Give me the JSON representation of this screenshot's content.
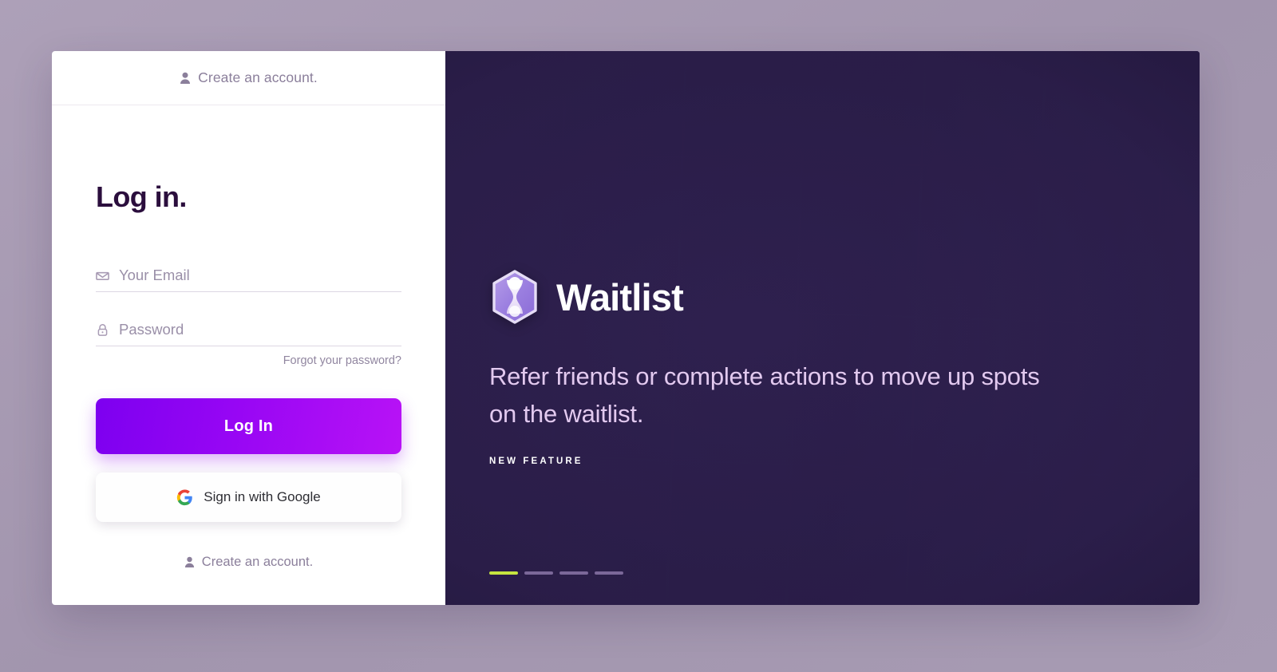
{
  "theme": {
    "page_bg": "#a99cb5",
    "panel_bg": "#2f2150",
    "accent_start": "#7d00f0",
    "accent_end": "#b812f6",
    "title_color": "#2b0e3d",
    "active_dot": "#c6e53f",
    "inactive_dot": "#7b6899",
    "tagline_color": "#e2c9ef"
  },
  "left": {
    "header_link": {
      "label": "Create an account.",
      "icon": "person-icon"
    },
    "title": "Log in.",
    "email": {
      "icon": "envelope-icon",
      "placeholder": "Your Email",
      "value": ""
    },
    "password": {
      "icon": "lock-icon",
      "placeholder": "Password",
      "value": ""
    },
    "forgot_password": "Forgot your password?",
    "login_button": "Log In",
    "google_button": {
      "label": "Sign in with Google",
      "icon": "google-g-icon"
    },
    "footer_link": {
      "label": "Create an account.",
      "icon": "person-icon"
    }
  },
  "right": {
    "logo_icon": "waitlist-hexagon-hourglass-icon",
    "brand_name": "Waitlist",
    "tagline": "Refer friends or complete actions to move up spots on the waitlist.",
    "feature_tag": "NEW FEATURE",
    "carousel": {
      "count": 4,
      "active_index": 0
    }
  }
}
